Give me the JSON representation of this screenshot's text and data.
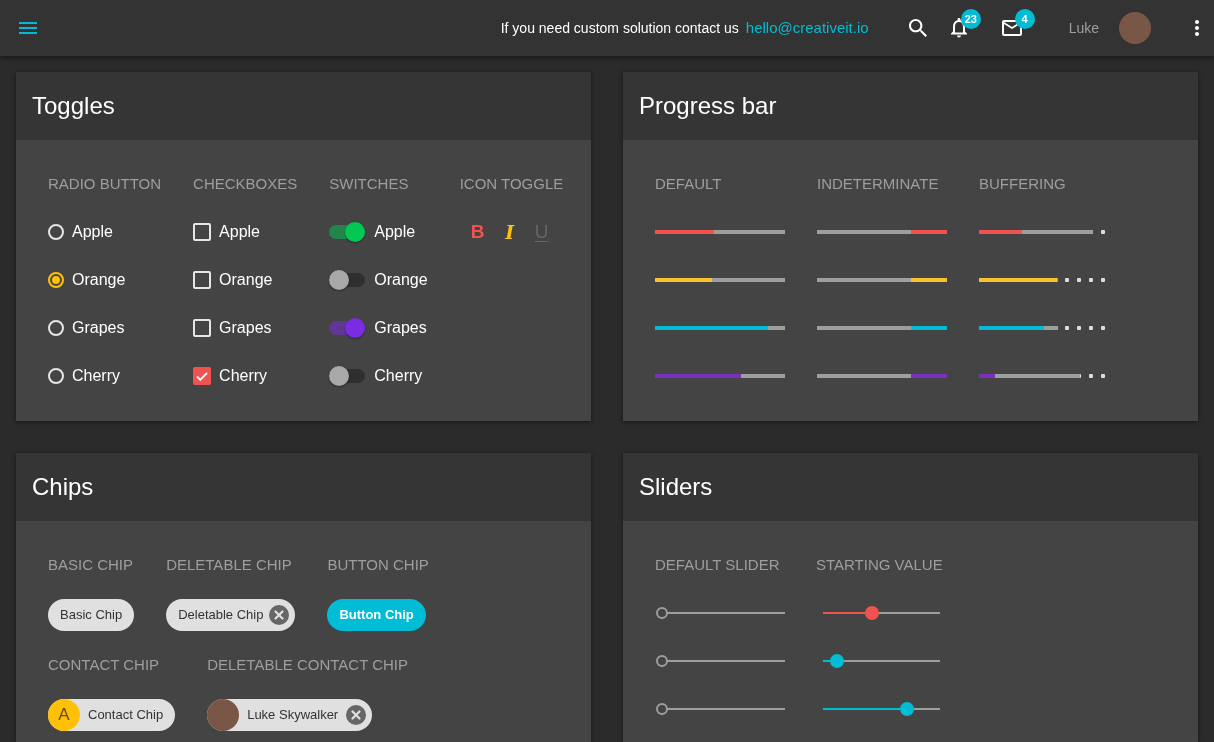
{
  "topbar": {
    "message": "If you need custom solution contact us",
    "email": "hello@creativeit.io",
    "notifications": {
      "count": "23"
    },
    "messages": {
      "count": "4"
    },
    "user": {
      "name": "Luke"
    }
  },
  "toggles": {
    "title": "Toggles",
    "radio_buttons": {
      "heading": "RADIO BUTTON",
      "items": [
        {
          "label": "Apple",
          "selected": false
        },
        {
          "label": "Orange",
          "selected": true
        },
        {
          "label": "Grapes",
          "selected": false
        },
        {
          "label": "Cherry",
          "selected": false
        }
      ]
    },
    "checkboxes": {
      "heading": "CHECKBOXES",
      "items": [
        {
          "label": "Apple",
          "checked": false
        },
        {
          "label": "Orange",
          "checked": false
        },
        {
          "label": "Grapes",
          "checked": false
        },
        {
          "label": "Cherry",
          "checked": true
        }
      ]
    },
    "switches": {
      "heading": "SWITCHES",
      "items": [
        {
          "label": "Apple",
          "on": true,
          "color": "#00c853"
        },
        {
          "label": "Orange",
          "on": false
        },
        {
          "label": "Grapes",
          "on": true,
          "color": "#7b2be2"
        },
        {
          "label": "Cherry",
          "on": false
        }
      ]
    },
    "icon_toggles": {
      "heading": "ICON TOGGLE",
      "items": [
        {
          "kind": "bold",
          "label": "B",
          "on": true,
          "color": "#ef5350"
        },
        {
          "kind": "italic",
          "label": "I",
          "on": true,
          "color": "#ffc107"
        },
        {
          "kind": "underline",
          "label": "U",
          "on": false
        }
      ]
    }
  },
  "progress_bar": {
    "title": "Progress bar",
    "default": {
      "heading": "DEFAULT",
      "bars": [
        {
          "color": "#ef5350",
          "level": 0.45
        },
        {
          "color": "#fbc02d",
          "level": 0.44
        },
        {
          "color": "#00bcd4",
          "level": 0.87
        },
        {
          "color": "#7b2fbe",
          "level": 0.66
        }
      ]
    },
    "indeterminate": {
      "heading": "INDETERMINATE",
      "bars": [
        {
          "color": "#ef5350"
        },
        {
          "color": "#fbc02d"
        },
        {
          "color": "#00bcd4"
        },
        {
          "color": "#7b2fbe"
        }
      ]
    },
    "buffering": {
      "heading": "BUFFERING",
      "bars": [
        {
          "color": "#ef5350",
          "level": 0.33,
          "buffer": {
            "level": 0.88
          }
        },
        {
          "color": "#fbc02d",
          "level": 0.6,
          "buffer": {
            "level": 0.61
          }
        },
        {
          "color": "#00bcd4",
          "level": 0.5,
          "buffer": {
            "level": 0.61
          }
        },
        {
          "color": "#7b2fbe",
          "level": 0.12,
          "buffer": {
            "level": 0.78
          }
        }
      ]
    }
  },
  "chips": {
    "title": "Chips",
    "rows": [
      {
        "groups": [
          {
            "heading": "BASIC CHIP",
            "chip": {
              "kind": "basic",
              "label": "Basic Chip"
            }
          },
          {
            "heading": "DELETABLE CHIP",
            "chip": {
              "kind": "deletable",
              "label": "Deletable Chip"
            }
          },
          {
            "heading": "BUTTON CHIP",
            "chip": {
              "kind": "button",
              "label": "Button Chip"
            }
          }
        ]
      },
      {
        "groups": [
          {
            "heading": "CONTACT CHIP",
            "chip": {
              "kind": "contact",
              "avatar_letter": "A",
              "label": "Contact Chip"
            }
          },
          {
            "heading": "DELETABLE CONTACT CHIP",
            "chip": {
              "kind": "deletable_contact",
              "label": "Luke Skywalker"
            }
          }
        ]
      }
    ]
  },
  "sliders": {
    "title": "Sliders",
    "default_slider": {
      "heading": "DEFAULT SLIDER",
      "sliders": [
        {
          "level": 0
        },
        {
          "level": 0
        },
        {
          "level": 0
        }
      ]
    },
    "starting_value": {
      "heading": "STARTING VALUE",
      "sliders": [
        {
          "color": "#ef5350",
          "level": 0.42
        },
        {
          "color": "#00bcd4",
          "level": 0.12
        },
        {
          "color": "#00bcd4",
          "level": 0.72
        }
      ]
    }
  }
}
